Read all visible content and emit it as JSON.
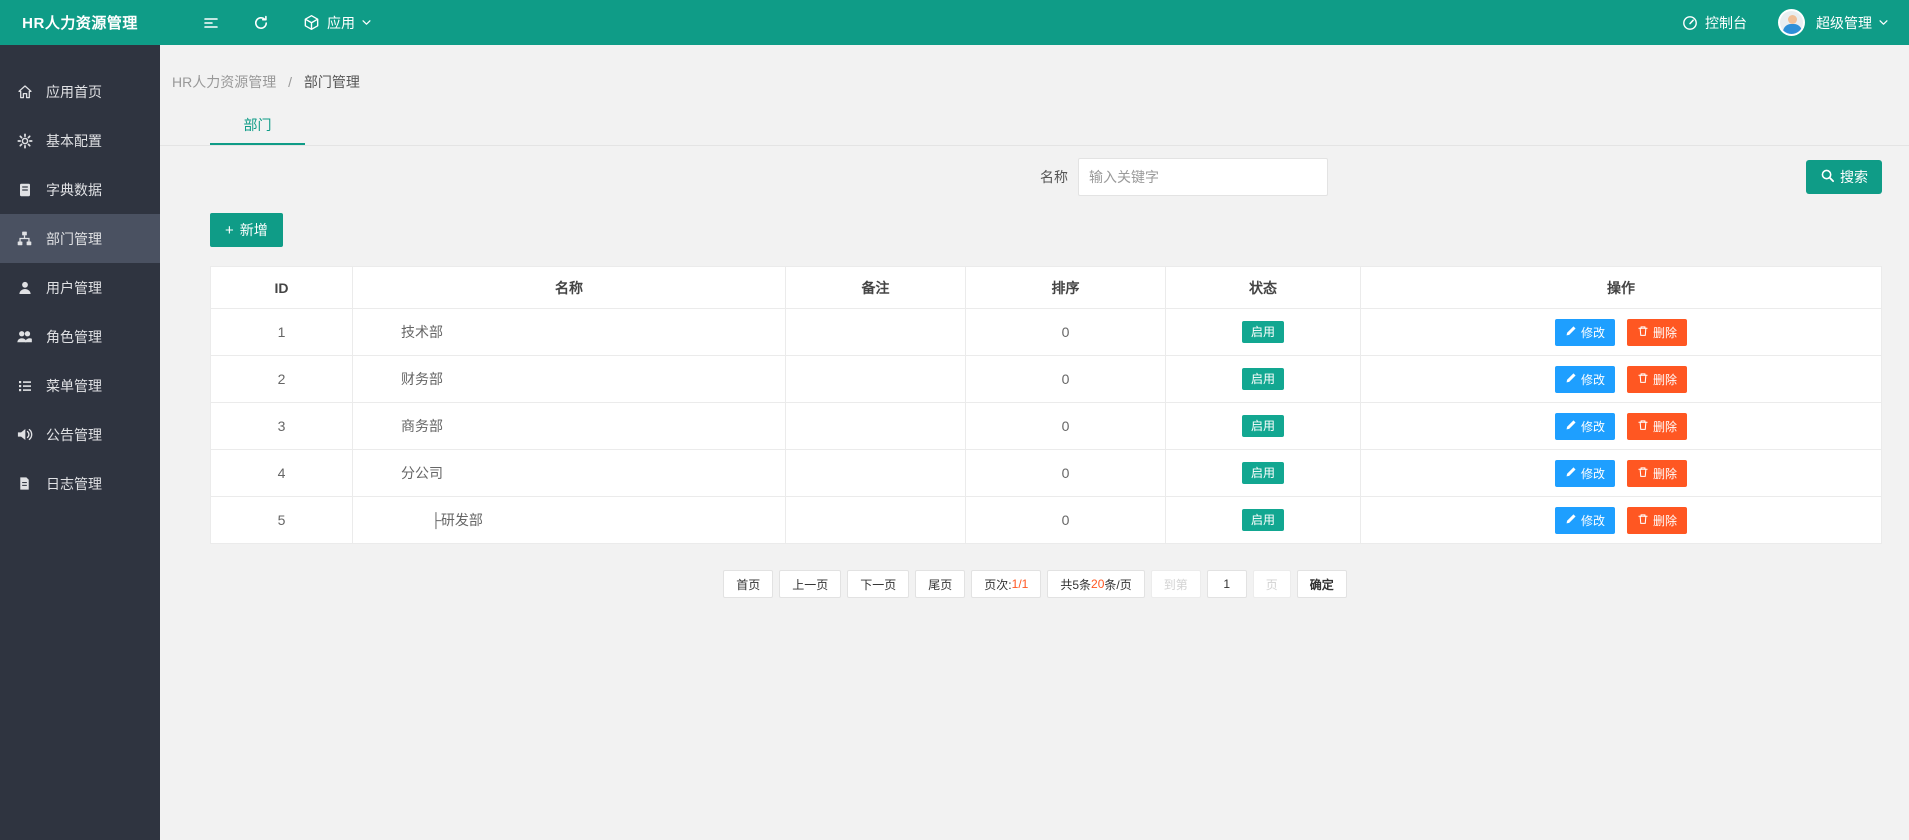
{
  "navbar": {
    "app_title": "HR人力资源管理",
    "menu_label": "应用",
    "console_label": "控制台",
    "user_label": "超级管理"
  },
  "sidebar": {
    "items": [
      {
        "label": "应用首页",
        "icon": "home",
        "active": false
      },
      {
        "label": "基本配置",
        "icon": "gear",
        "active": false
      },
      {
        "label": "字典数据",
        "icon": "book",
        "active": false
      },
      {
        "label": "部门管理",
        "icon": "org",
        "active": true
      },
      {
        "label": "用户管理",
        "icon": "user",
        "active": false
      },
      {
        "label": "角色管理",
        "icon": "users",
        "active": false
      },
      {
        "label": "菜单管理",
        "icon": "list",
        "active": false
      },
      {
        "label": "公告管理",
        "icon": "speaker",
        "active": false
      },
      {
        "label": "日志管理",
        "icon": "file",
        "active": false
      }
    ]
  },
  "breadcrumb": {
    "root": "HR人力资源管理",
    "separator": "/",
    "current": "部门管理"
  },
  "tab": {
    "label": "部门"
  },
  "search": {
    "label": "名称",
    "placeholder": "输入关键字",
    "value": "",
    "button": "搜索"
  },
  "toolbar": {
    "plus": "+",
    "add_label": "新增"
  },
  "table": {
    "columns": [
      "ID",
      "名称",
      "备注",
      "排序",
      "状态",
      "操作"
    ],
    "actions": {
      "edit": "修改",
      "delete": "删除"
    },
    "rows": [
      {
        "id": "1",
        "name": "技术部",
        "remark": "",
        "sort": "0",
        "status": "启用",
        "indent": false
      },
      {
        "id": "2",
        "name": "财务部",
        "remark": "",
        "sort": "0",
        "status": "启用",
        "indent": false
      },
      {
        "id": "3",
        "name": "商务部",
        "remark": "",
        "sort": "0",
        "status": "启用",
        "indent": false
      },
      {
        "id": "4",
        "name": "分公司",
        "remark": "",
        "sort": "0",
        "status": "启用",
        "indent": false
      },
      {
        "id": "5",
        "name": "├研发部",
        "remark": "",
        "sort": "0",
        "status": "启用",
        "indent": true
      }
    ]
  },
  "pagination": {
    "first": "首页",
    "prev": "上一页",
    "next": "下一页",
    "last": "尾页",
    "page_label": "页次:",
    "page_value": "1/1",
    "total_prefix": "共5条 ",
    "per_page_value": "20",
    "per_page_suffix": "条/页",
    "jump_label": "到第",
    "jump_value": "1",
    "jump_suffix": "页",
    "confirm": "确定"
  },
  "colors": {
    "primary": "#0f9c87",
    "sidebar_bg": "#2f3440",
    "sidebar_active": "#4a5161",
    "edit_button": "#1E9FFF",
    "delete_button": "#FF5722",
    "highlight_red": "#FF5722"
  }
}
